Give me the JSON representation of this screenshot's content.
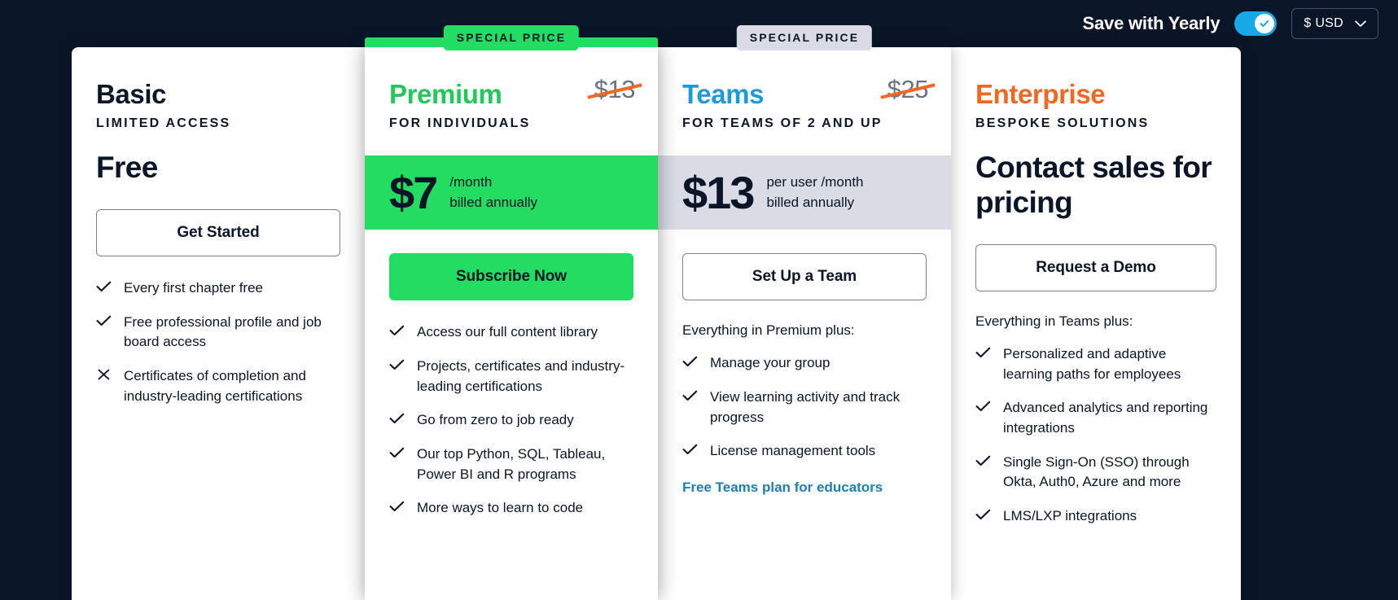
{
  "header": {
    "save_label": "Save with Yearly",
    "toggle_on": true,
    "toggle_icon": "check-icon",
    "currency_value": "$ USD",
    "currency_caret": "chevron-down-icon"
  },
  "plans": [
    {
      "id": "basic",
      "name": "Basic",
      "subtitle": "LIMITED ACCESS",
      "badge": null,
      "old_price": null,
      "price": "Free",
      "price_style": "plain",
      "price_note_1": null,
      "price_note_2": null,
      "cta": "Get Started",
      "cta_style": "outline",
      "feat_intro": null,
      "features": [
        {
          "icon": "check-icon",
          "text": "Every first chapter free"
        },
        {
          "icon": "check-icon",
          "text": "Free professional profile and job board access"
        },
        {
          "icon": "close-icon",
          "text": "Certificates of completion and industry-leading certifications"
        }
      ],
      "link": null
    },
    {
      "id": "premium",
      "name": "Premium",
      "subtitle": "FOR INDIVIDUALS",
      "badge": "SPECIAL PRICE",
      "old_price": "$13",
      "price": "$7",
      "price_style": "band-green",
      "price_note_1": "/month",
      "price_note_2": "billed annually",
      "cta": "Subscribe Now",
      "cta_style": "filled",
      "feat_intro": null,
      "features": [
        {
          "icon": "check-icon",
          "text": "Access our full content library"
        },
        {
          "icon": "check-icon",
          "text": "Projects, certificates and industry-leading certifications"
        },
        {
          "icon": "check-icon",
          "text": "Go from zero to job ready"
        },
        {
          "icon": "check-icon",
          "text": "Our top Python, SQL, Tableau, Power BI and R programs"
        },
        {
          "icon": "check-icon",
          "text": "More ways to learn to code"
        }
      ],
      "link": null
    },
    {
      "id": "teams",
      "name": "Teams",
      "subtitle": "FOR TEAMS OF 2 AND UP",
      "badge": "SPECIAL PRICE",
      "old_price": "$25",
      "price": "$13",
      "price_style": "band-gray",
      "price_note_1": "per user /month",
      "price_note_2": "billed annually",
      "cta": "Set Up a Team",
      "cta_style": "outline",
      "feat_intro": "Everything in Premium plus:",
      "features": [
        {
          "icon": "check-icon",
          "text": "Manage your group"
        },
        {
          "icon": "check-icon",
          "text": "View learning activity and track progress"
        },
        {
          "icon": "check-icon",
          "text": "License management tools"
        }
      ],
      "link": "Free Teams plan for educators"
    },
    {
      "id": "enterprise",
      "name": "Enterprise",
      "subtitle": "BESPOKE SOLUTIONS",
      "badge": null,
      "old_price": null,
      "price": "Contact sales for pricing",
      "price_style": "contact",
      "price_note_1": null,
      "price_note_2": null,
      "cta": "Request a Demo",
      "cta_style": "outline",
      "feat_intro": "Everything in Teams plus:",
      "features": [
        {
          "icon": "check-icon",
          "text": "Personalized and adaptive learning paths for employees"
        },
        {
          "icon": "check-icon",
          "text": "Advanced analytics and reporting integrations"
        },
        {
          "icon": "check-icon",
          "text": "Single Sign-On (SSO) through Okta, Auth0, Azure and more"
        },
        {
          "icon": "check-icon",
          "text": "LMS/LXP integrations"
        }
      ],
      "link": null
    }
  ],
  "colors": {
    "page_bg": "#0a1627",
    "green": "#22dd62",
    "green_text": "#22c85a",
    "blue": "#1e9ad6",
    "orange": "#f26722",
    "navy": "#0a1627",
    "toggle_blue": "#15a9e8",
    "link_blue": "#1e7fb5",
    "band_gray": "#d9dce5"
  }
}
